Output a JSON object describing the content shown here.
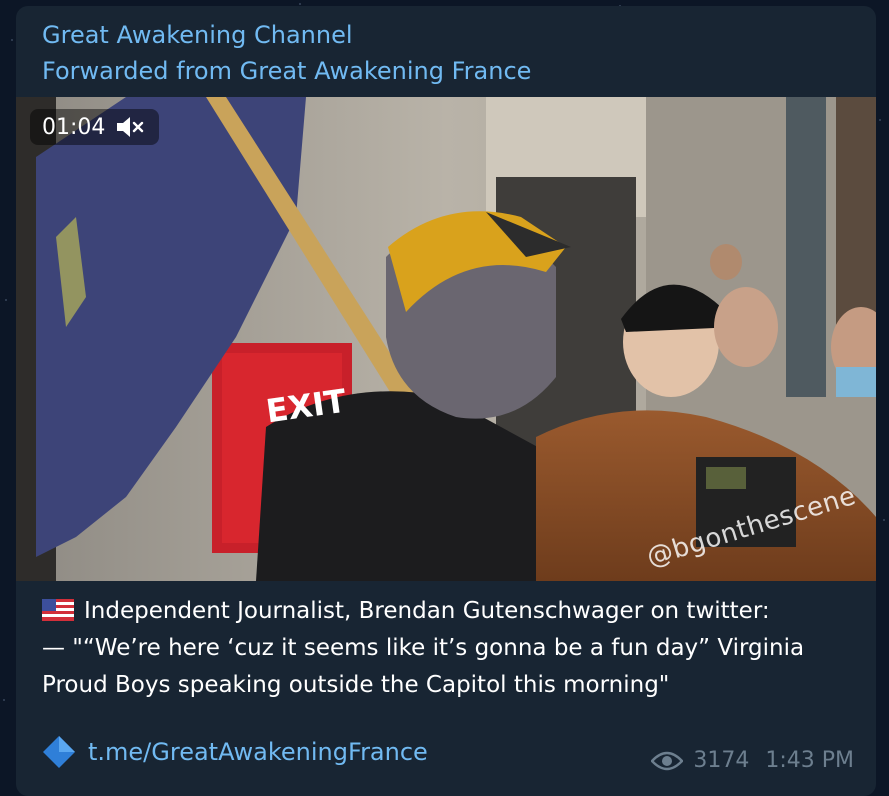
{
  "message": {
    "channel_title": "Great Awakening Channel",
    "forwarded_from": "Forwarded from Great Awakening France",
    "video": {
      "duration": "01:04",
      "mute_icon": "muted-speaker-icon",
      "watermark": "@bgonthescene",
      "sign_text": "EXIT"
    },
    "caption": {
      "flag_icon": "us-flag-icon",
      "line1": "Independent Journalist, Brendan Gutenschwager on twitter:",
      "line2": "— \"“We’re here ‘cuz it seems like it’s gonna be a fun day” Virginia",
      "line3": "Proud Boys speaking outside the Capitol this morning\""
    },
    "link": {
      "icon": "blue-diamond-icon",
      "text": "t.me/GreatAwakeningFrance"
    },
    "views_icon": "eye-icon",
    "views": "3174",
    "time": "1:43 PM"
  },
  "colors": {
    "background": "#0c1626",
    "bubble": "#182533",
    "accent": "#71baf2",
    "meta_text": "#6d7f8f"
  }
}
